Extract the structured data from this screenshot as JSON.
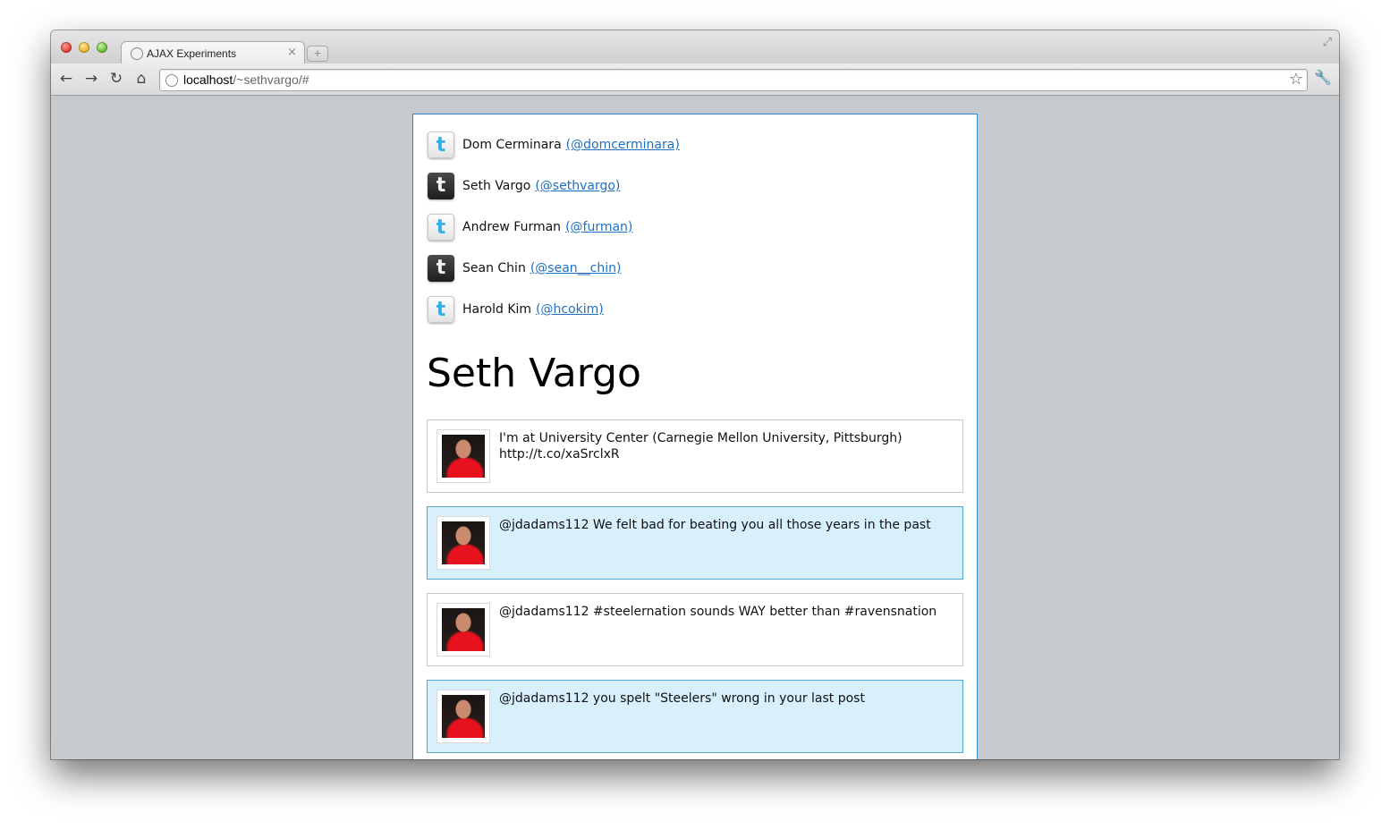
{
  "browser": {
    "tab_title": "AJAX Experiments",
    "tab_close": "×",
    "new_tab": "+",
    "url_host": "localhost",
    "url_path": "/~sethvargo/#",
    "icons": [
      "back-arrow-icon",
      "forward-arrow-icon",
      "reload-icon",
      "home-icon",
      "globe-icon",
      "star-icon",
      "wrench-icon",
      "expand-icon"
    ],
    "glyphs": {
      "back": "←",
      "forward": "→",
      "reload": "↻",
      "home": "⌂",
      "star": "☆",
      "wrench": "🔧",
      "expand": "⤢"
    }
  },
  "people": [
    {
      "name": "Dom Cerminara",
      "handle": "(@domcerminara)",
      "icon": "twitter-light-icon",
      "icon_letter": "t"
    },
    {
      "name": "Seth Vargo",
      "handle": "(@sethvargo)",
      "icon": "twitter-dark-icon",
      "icon_letter": "t"
    },
    {
      "name": "Andrew Furman",
      "handle": "(@furman)",
      "icon": "twitter-light-icon",
      "icon_letter": "t"
    },
    {
      "name": "Sean Chin",
      "handle": "(@sean__chin)",
      "icon": "twitter-dark-icon",
      "icon_letter": "t"
    },
    {
      "name": "Harold Kim",
      "handle": "(@hcokim)",
      "icon": "twitter-light-icon",
      "icon_letter": "t"
    }
  ],
  "selected_user": {
    "heading": "Seth Vargo"
  },
  "tweets": [
    {
      "text_line1": "I'm at University Center (Carnegie Mellon University, Pittsburgh)",
      "text_line2": "http://t.co/xaSrclxR"
    },
    {
      "text_line1": "@jdadams112 We felt bad for beating you all those years in the past",
      "text_line2": ""
    },
    {
      "text_line1": "@jdadams112 #steelernation sounds WAY better than #ravensnation",
      "text_line2": ""
    },
    {
      "text_line1": "@jdadams112 you spelt \"Steelers\" wrong in your last post",
      "text_line2": ""
    }
  ],
  "colors": {
    "link": "#1d6fc4",
    "container_border": "#2a86c8",
    "tweet_alt_bg": "#d7f0fc",
    "page_bg": "#c6c9cd"
  }
}
